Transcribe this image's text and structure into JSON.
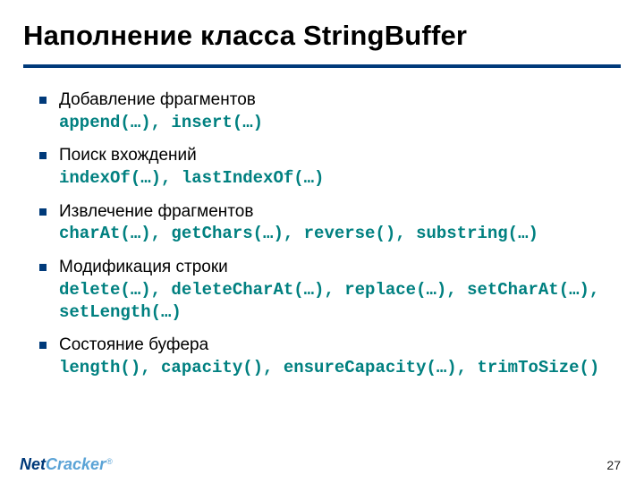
{
  "title": "Наполнение класса StringBuffer",
  "items": [
    {
      "label": "Добавление фрагментов",
      "code": "append(…), insert(…)"
    },
    {
      "label": "Поиск вхождений",
      "code": "indexOf(…), lastIndexOf(…)"
    },
    {
      "label": "Извлечение фрагментов",
      "code": "charAt(…), getChars(…), reverse(), substring(…)"
    },
    {
      "label": "Модификация строки",
      "code": "delete(…), deleteCharAt(…), replace(…), setCharAt(…), setLength(…)"
    },
    {
      "label": "Состояние буфера",
      "code": "length(), capacity(), ensureCapacity(…), trimToSize()"
    }
  ],
  "logo": {
    "part1": "Net",
    "part2": "Cracker",
    "reg": "®"
  },
  "page_number": "27"
}
